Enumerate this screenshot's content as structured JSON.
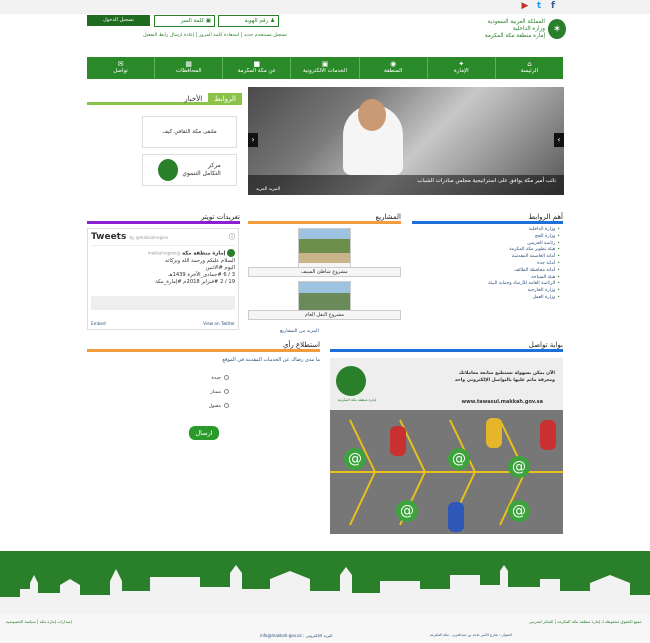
{
  "header": {
    "org_line1": "المملكة العربية السعودية",
    "org_line2": "وزارة الداخلية",
    "org_line3": "إمارة منطقة مكة المكرمة",
    "social": [
      "f",
      "▶",
      "t"
    ],
    "login_button": "تسجيل الدخول",
    "password_placeholder": "كلمة السر",
    "id_placeholder": "رقم الهوية",
    "login_links": "تسجيل مستخدم جديد | استعادة كلمة المرور | إعادة ارسال رابط التفعيل"
  },
  "nav": [
    {
      "label": "الرئيسة",
      "icon": "home-icon",
      "glyph": "⌂"
    },
    {
      "label": "الإمارة",
      "icon": "emblem-icon",
      "glyph": "✦"
    },
    {
      "label": "المنطقة",
      "icon": "location-icon",
      "glyph": "◉"
    },
    {
      "label": "الخدمات الالكترونية",
      "icon": "services-icon",
      "glyph": "▣"
    },
    {
      "label": "عن مكة المكرمة",
      "icon": "kaaba-icon",
      "glyph": "■"
    },
    {
      "label": "المحافظات",
      "icon": "cities-icon",
      "glyph": "▦"
    },
    {
      "label": "تواصل",
      "icon": "contact-icon",
      "glyph": "✉"
    }
  ],
  "tabs": {
    "links": "الروابط",
    "news": "الأخبار"
  },
  "banners": {
    "b1": "ملتقى مكة الثقافي كيف",
    "b2_line1": "مركز",
    "b2_line2": "التكامل التنموي"
  },
  "slider": {
    "caption": "نائب أمير مكة يوافق على استراتيجية مجلس مبادرات الشباب",
    "more": "المزيد المزيد"
  },
  "sections": {
    "links_title": "أهم الروابط",
    "projects_title": "المشاريع",
    "twitter_title": "تغريدات تويتر",
    "poll_title": "استطلاع رأي",
    "tawasul_title": "بوابة تواصل"
  },
  "important_links": [
    "وزارة الداخلية",
    "وزارة الحج",
    "رئاسة الحرمين",
    "هيئة تطوير مكة المكرمة",
    "أمانة العاصمة المقدسة",
    "أمانة جدة",
    "أمانة محافظة الطائف",
    "هيئة السياحة",
    "الرئاسة العامة للأرصاد وحماية البيئة",
    "وزارة الخارجية",
    "وزارة العمل"
  ],
  "projects": [
    {
      "label": "مشروع شاطئ السيف"
    },
    {
      "label": "مشروع النقل العام"
    }
  ],
  "projects_more": "المزيد من المشاريع",
  "twitter": {
    "heading": "Tweets",
    "by": "by @makkahregion",
    "account": "إمارة منطقة مكة",
    "handle": "@makkahregion",
    "line1": "السلام عليكم ورحمة الله وبركاته",
    "line2": "اليوم #الاثنين",
    "line3": "3 / 6 #جمادى_الآخرة 1439هـ",
    "line4": "19 / 2 #فبراير 2018م #إمارة_مكة",
    "embed": "Embed",
    "view": "View on Twitter"
  },
  "poll": {
    "question": "ما مدى رضاك عن الخدمات المقدمة في الموقع",
    "options": [
      "جيدة",
      "ممتاز",
      "مقبول"
    ],
    "submit": "ارسال"
  },
  "tawasul": {
    "text1": "الآن يمكن بسهولة تستطيع متابعة معاملاتك",
    "text2": "ومعرفة ماتم عليها بالتواصل الإلكتروني واحد",
    "url": "www.tawasul.makkah.gov.sa",
    "logo_text": "إمارة منطقة مكة المكرمة"
  },
  "footer": {
    "right_text": "جميع الحقوق محفوظة لـ إمارة منطقة مكة المكرمة | الشكر لتجربتي",
    "email": "البريد الالكتروني : info@makkah-gov.sa",
    "address": "العنوان : شارع الأمير ماجد بن عبدالعزيز - مكة المكرمة",
    "left_text": "إصدارات إمارة مكة | سياسة الخصوصية"
  }
}
